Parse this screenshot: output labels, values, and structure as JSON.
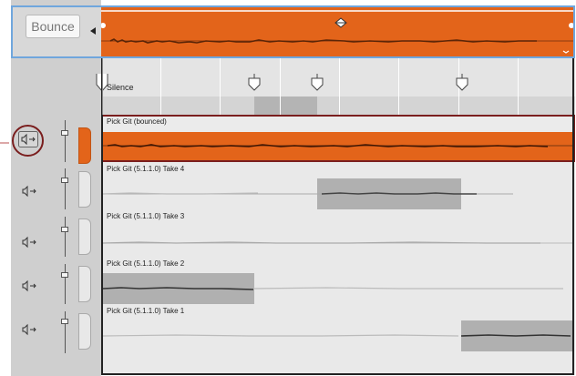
{
  "toolbar": {
    "bounce_label": "Bounce"
  },
  "markers": {
    "silence_label": "Silence"
  },
  "tracks": [
    {
      "label": "Pick Git (bounced)"
    },
    {
      "label": "Pick Git (5.1.1.0) Take 4"
    },
    {
      "label": "Pick Git (5.1.1.0) Take 3"
    },
    {
      "label": "Pick Git (5.1.1.0) Take 2"
    },
    {
      "label": "Pick Git (5.1.1.0) Take 1"
    }
  ],
  "colors": {
    "accent_orange": "#e3641a",
    "selection_border": "#7a1e1e",
    "top_row_border": "#6fa6dd"
  },
  "icons": {
    "speaker": "speaker-arrow-icon",
    "fader": "fader-icon"
  }
}
